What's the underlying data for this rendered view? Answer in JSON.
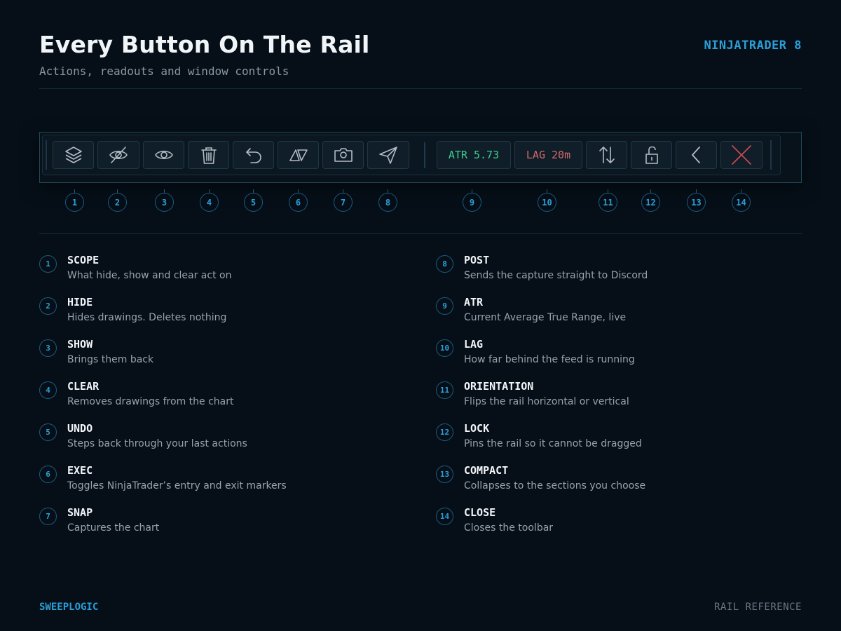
{
  "header": {
    "title": "Every Button On The Rail",
    "subtitle": "Actions, readouts and window controls",
    "brand_tag": "NINJATRADER 8"
  },
  "rail": {
    "buttons": [
      {
        "number": "1",
        "icon": "layers-icon"
      },
      {
        "number": "2",
        "icon": "eye-off-icon"
      },
      {
        "number": "3",
        "icon": "eye-icon"
      },
      {
        "number": "4",
        "icon": "trash-icon"
      },
      {
        "number": "5",
        "icon": "undo-icon"
      },
      {
        "number": "6",
        "icon": "exec-triangles-icon"
      },
      {
        "number": "7",
        "icon": "camera-icon"
      },
      {
        "number": "8",
        "icon": "send-icon"
      },
      {
        "number": "9",
        "icon": "atr-readout"
      },
      {
        "number": "10",
        "icon": "lag-readout"
      },
      {
        "number": "11",
        "icon": "up-down-arrows-icon"
      },
      {
        "number": "12",
        "icon": "unlock-icon"
      },
      {
        "number": "13",
        "icon": "chevron-left-icon"
      },
      {
        "number": "14",
        "icon": "close-icon"
      }
    ],
    "atr_label": "ATR 5.73",
    "lag_label": "LAG 20m",
    "colors": {
      "atr": "#3fcf8e",
      "lag": "#d26a6a",
      "close": "#c8494f",
      "icon": "#b3bcc4"
    }
  },
  "legend": {
    "items": [
      {
        "number": "1",
        "name": "SCOPE",
        "desc": "What hide, show and clear act on"
      },
      {
        "number": "2",
        "name": "HIDE",
        "desc": "Hides drawings. Deletes nothing"
      },
      {
        "number": "3",
        "name": "SHOW",
        "desc": "Brings them back"
      },
      {
        "number": "4",
        "name": "CLEAR",
        "desc": "Removes drawings from the chart"
      },
      {
        "number": "5",
        "name": "UNDO",
        "desc": "Steps back through your last actions"
      },
      {
        "number": "6",
        "name": "EXEC",
        "desc": "Toggles NinjaTrader’s entry and exit markers"
      },
      {
        "number": "7",
        "name": "SNAP",
        "desc": "Captures the chart"
      },
      {
        "number": "8",
        "name": "POST",
        "desc": "Sends the capture straight to Discord"
      },
      {
        "number": "9",
        "name": "ATR",
        "desc": "Current Average True Range, live"
      },
      {
        "number": "10",
        "name": "LAG",
        "desc": "How far behind the feed is running"
      },
      {
        "number": "11",
        "name": "ORIENTATION",
        "desc": "Flips the rail horizontal or vertical"
      },
      {
        "number": "12",
        "name": "LOCK",
        "desc": "Pins the rail so it cannot be dragged"
      },
      {
        "number": "13",
        "name": "COMPACT",
        "desc": "Collapses to the sections you choose"
      },
      {
        "number": "14",
        "name": "CLOSE",
        "desc": "Closes the toolbar"
      }
    ]
  },
  "footer": {
    "brand": "SWEEPLOGIC",
    "label": "RAIL REFERENCE"
  }
}
